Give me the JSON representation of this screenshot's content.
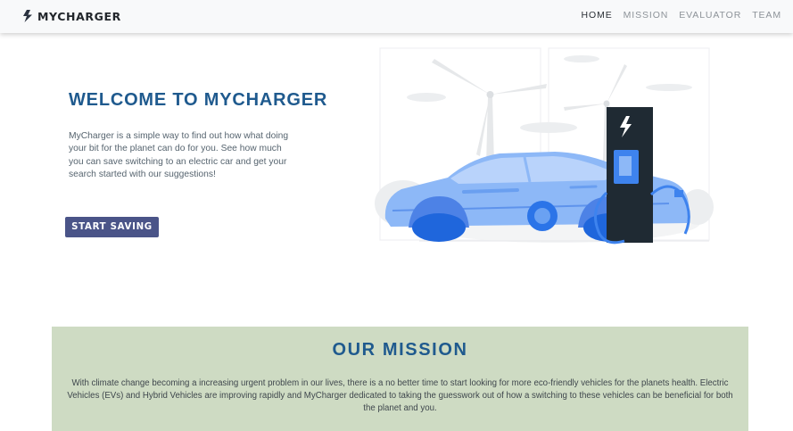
{
  "navbar": {
    "brand": "MYCHARGER",
    "brand_icon": "lightning-bolt-icon",
    "links": [
      {
        "label": "HOME",
        "active": true
      },
      {
        "label": "MISSION",
        "active": false
      },
      {
        "label": "EVALUATOR",
        "active": false
      },
      {
        "label": "TEAM",
        "active": false
      }
    ]
  },
  "hero": {
    "title": "WELCOME TO MYCHARGER",
    "text": "MyCharger is a simple way to find out how what doing your bit for the planet can do for you. See how much you can save switching to an electric car and get your search started with our suggestions!",
    "button_label": "START SAVING",
    "illustration": "electric-car-charging-illustration"
  },
  "mission": {
    "title": "OUR MISSION",
    "text": "With climate change becoming a increasing urgent problem in our lives, there is a no better time to start looking for more eco-friendly vehicles for the planets health. Electric Vehicles (EVs) and Hybrid Vehicles are improving rapidly and MyCharger dedicated to taking the guesswork out of how a switching to these vehicles can be beneficial for both the planet and you."
  },
  "colors": {
    "accent_title": "#1f5a8e",
    "button_bg": "#4a5488",
    "mission_bg": "#cedbc3",
    "navbar_bg": "#f8f9fa"
  }
}
